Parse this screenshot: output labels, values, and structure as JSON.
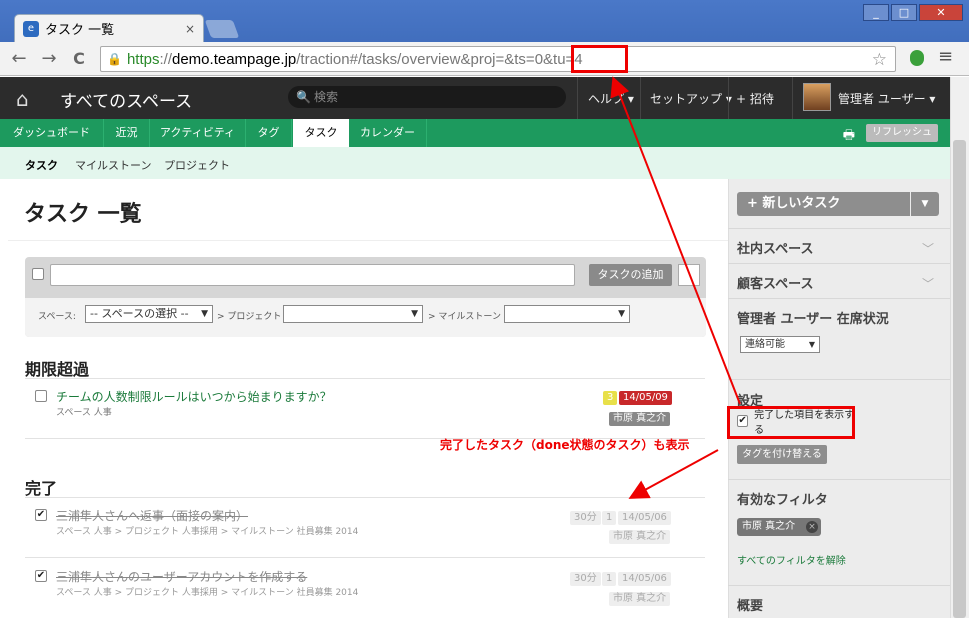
{
  "browser": {
    "tab_title": "タスク 一覧",
    "tab_close": "×",
    "window_buttons": [
      "_",
      "□",
      "✕"
    ],
    "url_scheme": "https",
    "url_sep": "://",
    "url_host": "demo.teampage.jp",
    "url_rest": "/traction#/tasks/overview&proj=&ts=0&tu=4",
    "nav_back": "←",
    "nav_forward": "→",
    "nav_reload": "C",
    "star": "☆",
    "menu": "≡"
  },
  "header": {
    "home_icon": "⌂",
    "spaces": "すべてのスペース",
    "search_placeholder": "検索",
    "search_icon": "🔍",
    "help": "ヘルプ ▾",
    "setup": "セットアップ ▾",
    "invite": "+ 招待",
    "user": "管理者 ユーザー ▾"
  },
  "nav": {
    "tabs": [
      "ダッシュボード",
      "近況",
      "アクティビティ",
      "タグ",
      "タスク",
      "カレンダー"
    ],
    "active": "タスク",
    "print_icon": "🖶",
    "refresh": "リフレッシュ"
  },
  "subnav": {
    "items": [
      "タスク",
      "マイルストーン",
      "プロジェクト"
    ]
  },
  "page": {
    "title": "タスク 一覧"
  },
  "filter": {
    "add_task_button": "タスクの追加",
    "space_label": "スペース:",
    "space_select": "-- スペースの選択 --",
    "project_label": "> プロジェクト",
    "milestone_label": "> マイルストーン",
    "arrow": "▼"
  },
  "sections": {
    "overdue": "期限超過",
    "done": "完了"
  },
  "tasks": {
    "overdue": [
      {
        "title": "チームの人数制限ルールはいつから始まりますか？",
        "path": "スペース 人事",
        "count": "3",
        "date": "14/05/09",
        "assignee": "市原 真之介"
      }
    ],
    "done": [
      {
        "title": "三浦隼人さんへ返事（面接の案内）",
        "path": "スペース 人事 > プロジェクト 人事採用 > マイルストーン 社員募集 2014",
        "duration": "30分",
        "count": "1",
        "date": "14/05/06",
        "assignee": "市原 真之介"
      },
      {
        "title": "三浦隼人さんのユーザーアカウントを作成する",
        "path": "スペース 人事 > プロジェクト 人事採用 > マイルストーン 社員募集 2014",
        "duration": "30分",
        "count": "1",
        "date": "14/05/06",
        "assignee": "市原 真之介"
      }
    ]
  },
  "sidebar": {
    "new_task": "+ 新しいタスク",
    "new_task_dropdown": "▼",
    "internal_spaces": "社内スペース",
    "customer_spaces": "顧客スペース",
    "presence_title": "管理者 ユーザー 在席状況",
    "presence_value": "連絡可能",
    "presence_arrow": "▼",
    "settings_title": "設定",
    "show_done": "完了した項目を表示する",
    "retag_button": "タグを付け替える",
    "active_filters": "有効なフィルタ",
    "filter_chip": "市原 真之介",
    "filter_chip_x": "×",
    "clear_filters": "すべてのフィルタを解除",
    "overview": "概要",
    "chevron": "﹀"
  },
  "annotation": {
    "text": "完了したタスク（done状態のタスク）も表示",
    "color": "#e00000"
  }
}
